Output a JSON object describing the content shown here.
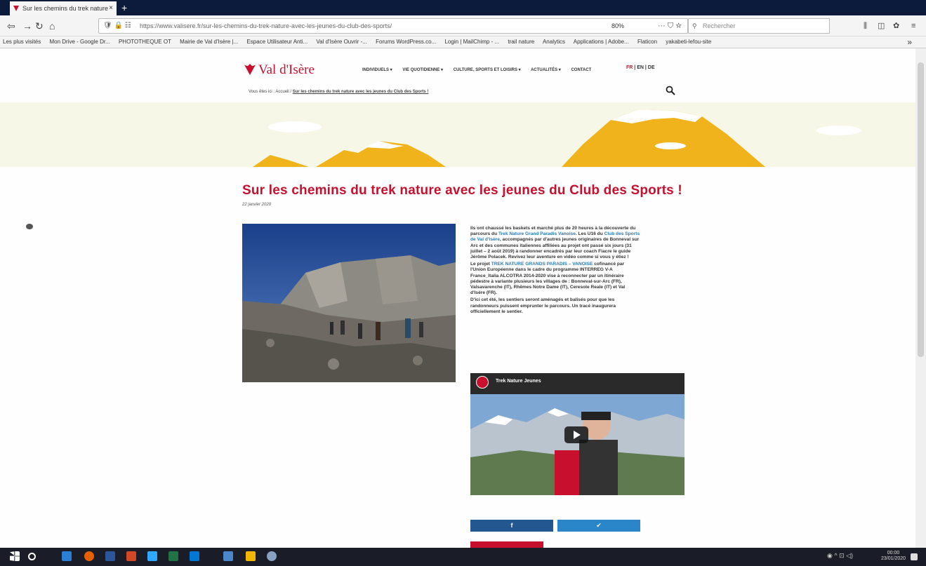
{
  "browser": {
    "tab_title": "Sur les chemins du trek nature",
    "tab_close": "×",
    "new_tab": "+",
    "url": "https://www.valisere.fr/sur-les-chemins-du-trek-nature-avec-les-jeunes-du-club-des-sports/",
    "zoom": "80%",
    "search_placeholder": "Rechercher",
    "bookmarks": [
      "Les plus visités",
      "Mon Drive - Google Dr...",
      "PHOTOTHEQUE OT",
      "Mairie de Val d'Isère |...",
      "Espace Utilisateur Anti...",
      "Val d'Isère Ouvrir -...",
      "Forums WordPress.co...",
      "Login | MailChimp - ...",
      "trail nature",
      "Analytics",
      "Applications | Adobe...",
      "Flaticon",
      "yakabeti-lefou-site"
    ],
    "more": "»"
  },
  "site": {
    "logo": "Val d'Isère",
    "menu": [
      "INDIVIDUELS ▾",
      "VIE QUOTIDIENNE ▾",
      "CULTURE, SPORTS ET LOISIRS ▾",
      "ACTUALITÉS ▾",
      "CONTACT"
    ],
    "lang_fr": "FR",
    "lang_rest": "| EN | DE",
    "breadcrumb_prefix": "Vous êtes ici : Accueil / ",
    "breadcrumb_current": "Sur les chemins du trek nature avec les jeunes du Club des Sports !"
  },
  "article": {
    "title": "Sur les chemins du trek nature avec les jeunes du Club des Sports !",
    "date": "22 janvier 2020",
    "p1_a": "Ils ont chaussé les baskets et marché plus de 20 heures à la découverte du parcours du ",
    "p1_link1": "Trek Nature Grand Paradis Vanoise",
    "p1_b": ". Les U16 du ",
    "p1_link2": "Club des Sports de Val d'Isère",
    "p1_c": ", accompagnés par d'autres jeunes originaires de Bonneval sur Arc et des communes italiennes affiliées au projet ont passé six jours (31 juillet – 2 août 2019) à randonner encadrés par leur coach Fiacre le guide Jérôme Polacek. Revivez leur aventure en vidéo comme si vous y étiez !",
    "p2_a": "Le projet ",
    "p2_link": "TREK NATURE GRANDS PARADIS – VANOISE",
    "p2_b": " cofinancé par l'Union Européenne dans le cadre du programme INTERREG V-A France_Italia ALCOTRA 2014-2020 vise à reconnecter par un itinéraire pédestre à variante plusieurs les villages de : Bonneval-sur-Arc (FR), Valsavarenche (IT), Rhêmes Notre Dame (IT), Ceresole Reale (IT) et Val d'Isère (FR).",
    "p3": "D'ici cet été, les sentiers seront aménagés et balisés pour que les randonneurs puissent emprunter le parcours. Un tracé inaugurera officiellement le sentier.",
    "video_title": "Trek Nature Jeunes",
    "share_fb": "f",
    "share_tw": "✔"
  },
  "taskbar": {
    "time": "00:00",
    "date": "23/01/2020"
  },
  "colors": {
    "brand_red": "#c8102e",
    "facebook": "#22588f",
    "twitter": "#2a86c9"
  }
}
